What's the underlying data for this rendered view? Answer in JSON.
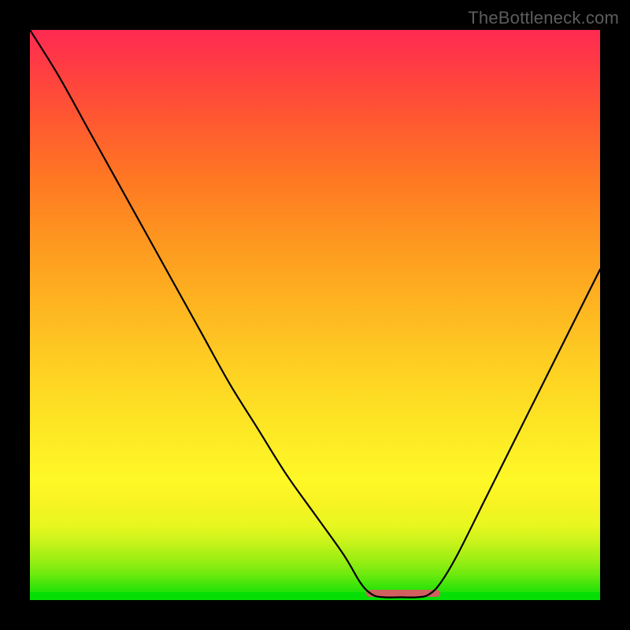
{
  "watermark": "TheBottleneck.com",
  "colors": {
    "background": "#000000",
    "gradient_top": "#ff2a52",
    "gradient_mid": "#fde124",
    "gradient_bottom": "#05df05",
    "curve": "#000000",
    "marker": "#d06060",
    "watermark_text": "#5d5d5d"
  },
  "chart_data": {
    "type": "line",
    "title": "",
    "xlabel": "",
    "ylabel": "",
    "xlim": [
      0,
      100
    ],
    "ylim": [
      0,
      100
    ],
    "grid": false,
    "x": [
      0,
      5,
      10,
      15,
      20,
      25,
      30,
      35,
      40,
      45,
      50,
      55,
      58,
      60,
      62,
      65,
      68,
      70,
      72,
      75,
      80,
      85,
      90,
      95,
      100
    ],
    "values": [
      100,
      92,
      83,
      74,
      65,
      56,
      47,
      38,
      30,
      22,
      15,
      8,
      3,
      1,
      0.5,
      0.5,
      0.5,
      1,
      3,
      8,
      18,
      28,
      38,
      48,
      58
    ],
    "note": "V-shaped bottleneck curve; x in percent across range, y is relative bottleneck from 0 (optimal) to 100 (severe). Flat trough ~62–68% marked with salmon segment."
  },
  "marker": {
    "x_start_pct": 59,
    "x_end_pct": 72
  }
}
